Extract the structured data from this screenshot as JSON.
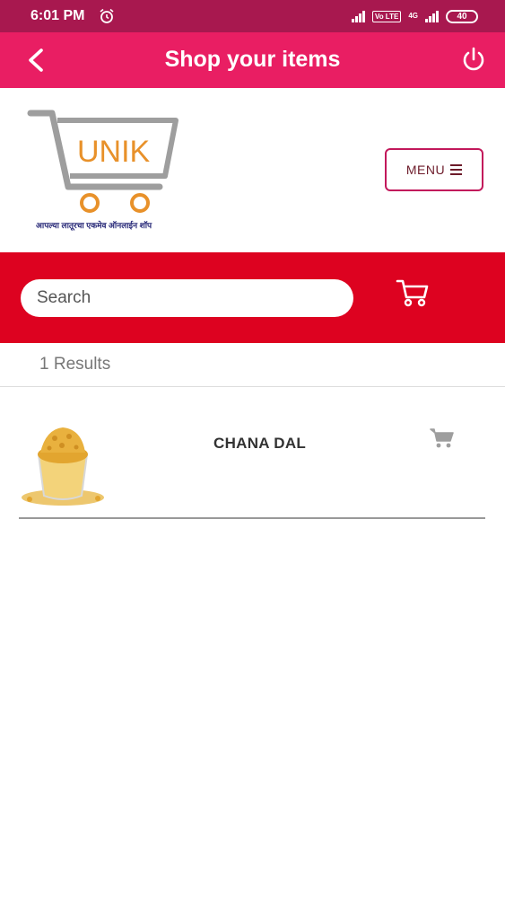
{
  "status_bar": {
    "time": "6:01 PM",
    "battery": "40",
    "net_badge": "Vo LTE",
    "net_type": "4G"
  },
  "app_bar": {
    "title": "Shop your items"
  },
  "logo": {
    "brand": "UNIK",
    "tagline": "आपल्या लातूरचा एकमेव ऑनलाईन शॉप"
  },
  "menu": {
    "label": "MENU"
  },
  "search": {
    "placeholder": "Search",
    "value": ""
  },
  "results": {
    "count_label": "1 Results"
  },
  "products": [
    {
      "name": "CHANA DAL"
    }
  ],
  "colors": {
    "status_bar": "#a8184f",
    "app_bar": "#e91e63",
    "search_band": "#dd0220",
    "logo_orange": "#e8912a",
    "logo_gray": "#9e9e9e"
  }
}
